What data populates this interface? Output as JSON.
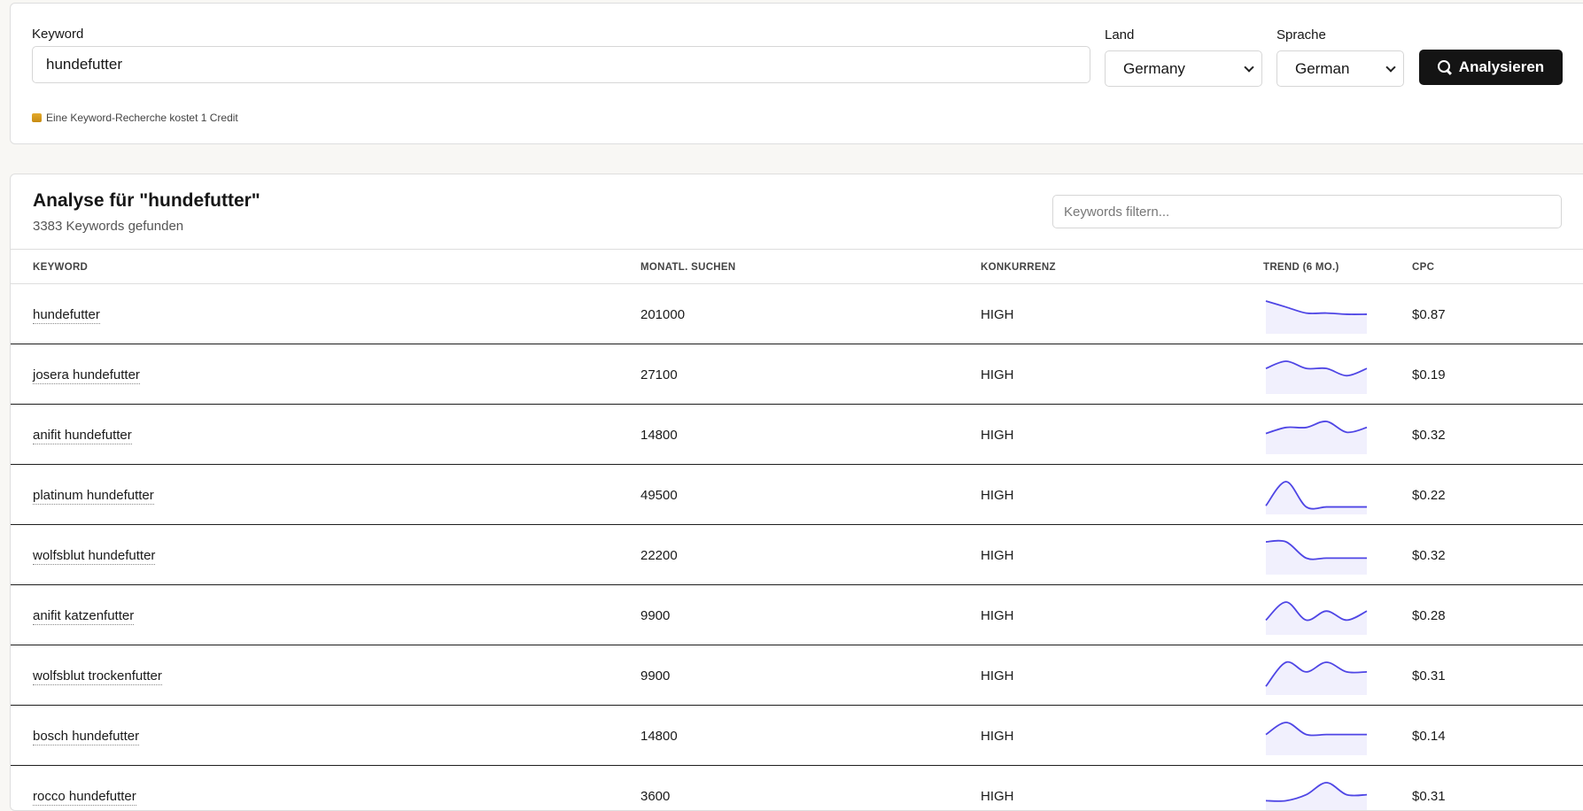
{
  "search": {
    "keyword_label": "Keyword",
    "keyword_value": "hundefutter",
    "country_label": "Land",
    "country_value": "Germany",
    "language_label": "Sprache",
    "language_value": "German",
    "analyze_label": "Analysieren",
    "credit_note": "Eine Keyword-Recherche kostet 1 Credit"
  },
  "results": {
    "title": "Analyse für \"hundefutter\"",
    "count": "3383 Keywords gefunden",
    "filter_placeholder": "Keywords filtern...",
    "columns": {
      "keyword": "KEYWORD",
      "searches": "MONATL. SUCHEN",
      "competition": "KONKURRENZ",
      "trend": "TREND (6 MO.)",
      "cpc": "CPC"
    },
    "rows": [
      {
        "keyword": "hundefutter",
        "searches": "201000",
        "competition": "HIGH",
        "cpc": "$0.87",
        "trend": [
          100,
          90,
          80,
          80,
          78,
          78
        ]
      },
      {
        "keyword": "josera hundefutter",
        "searches": "27100",
        "competition": "HIGH",
        "cpc": "$0.19",
        "trend": [
          88,
          100,
          88,
          88,
          76,
          88
        ]
      },
      {
        "keyword": "anifit hundefutter",
        "searches": "14800",
        "competition": "HIGH",
        "cpc": "$0.32",
        "trend": [
          80,
          90,
          90,
          100,
          82,
          90
        ]
      },
      {
        "keyword": "platinum hundefutter",
        "searches": "49500",
        "competition": "HIGH",
        "cpc": "$0.22",
        "trend": [
          60,
          100,
          58,
          58,
          58,
          58
        ]
      },
      {
        "keyword": "wolfsblut hundefutter",
        "searches": "22200",
        "competition": "HIGH",
        "cpc": "$0.32",
        "trend": [
          100,
          100,
          73,
          73,
          73,
          73
        ]
      },
      {
        "keyword": "anifit katzenfutter",
        "searches": "9900",
        "competition": "HIGH",
        "cpc": "$0.28",
        "trend": [
          70,
          100,
          70,
          85,
          70,
          85
        ]
      },
      {
        "keyword": "wolfsblut trockenfutter",
        "searches": "9900",
        "competition": "HIGH",
        "cpc": "$0.31",
        "trend": [
          60,
          100,
          84,
          100,
          84,
          84
        ]
      },
      {
        "keyword": "bosch hundefutter",
        "searches": "14800",
        "competition": "HIGH",
        "cpc": "$0.14",
        "trend": [
          80,
          100,
          80,
          80,
          80,
          80
        ]
      },
      {
        "keyword": "rocco hundefutter",
        "searches": "3600",
        "competition": "HIGH",
        "cpc": "$0.31",
        "trend": [
          70,
          70,
          80,
          100,
          80,
          80
        ]
      }
    ]
  },
  "colors": {
    "accent": "#4f46e5",
    "button_bg": "#141414",
    "page_bg": "#f8f7f4"
  },
  "icons": {
    "analyze": "search-icon",
    "credit": "coin-icon"
  }
}
